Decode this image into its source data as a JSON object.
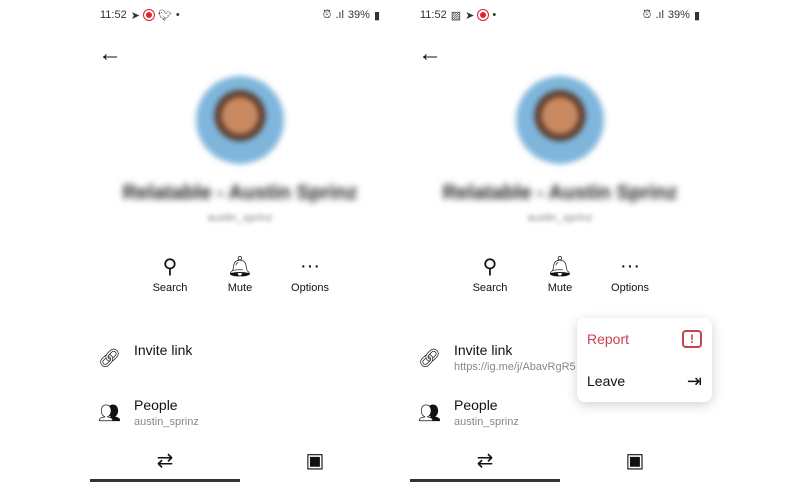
{
  "screens": [
    {
      "status": {
        "time": "11:52",
        "battery": "39%"
      },
      "profile": {
        "name": "Relatable - Austin Sprinz",
        "username": "austin_sprinz"
      },
      "actions": [
        {
          "label": "Search",
          "icon": "search-icon"
        },
        {
          "label": "Mute",
          "icon": "bell-icon"
        },
        {
          "label": "Options",
          "icon": "more-icon"
        }
      ],
      "invite": {
        "title": "Invite link",
        "value": ""
      },
      "people": {
        "title": "People",
        "value": "austin_sprinz"
      }
    },
    {
      "status": {
        "time": "11:52",
        "battery": "39%"
      },
      "profile": {
        "name": "Relatable - Austin Sprinz",
        "username": "austin_sprinz"
      },
      "actions": [
        {
          "label": "Search",
          "icon": "search-icon"
        },
        {
          "label": "Mute",
          "icon": "bell-icon"
        },
        {
          "label": "Options",
          "icon": "more-icon"
        }
      ],
      "invite": {
        "title": "Invite link",
        "value": "https://ig.me/j/AbavRgR5"
      },
      "people": {
        "title": "People",
        "value": "austin_sprinz"
      },
      "menu": {
        "report": "Report",
        "leave": "Leave"
      }
    }
  ],
  "colors": {
    "report": "#c8414d",
    "notification": "#e0202a"
  }
}
